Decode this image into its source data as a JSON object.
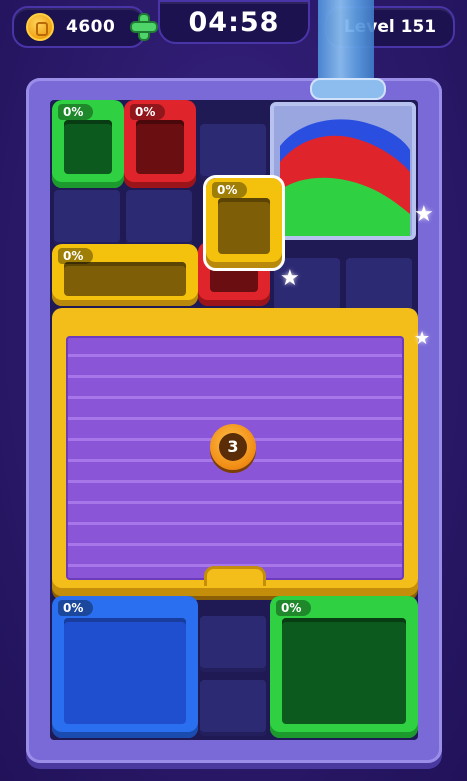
{
  "hud": {
    "coins": "4600",
    "timer": "04:58",
    "level": "Level 151"
  },
  "boxes": {
    "green_top": {
      "percent": "0%",
      "color": "#2fd142"
    },
    "red_top": {
      "percent": "0%",
      "color": "#e0242c"
    },
    "yellow_floating": {
      "percent": "0%",
      "color": "#f4c20d"
    },
    "yellow_long": {
      "percent": "0%",
      "color": "#f4c20d"
    },
    "blue_bottom": {
      "percent": "0%",
      "color": "#2a6ff0"
    },
    "green_bottom": {
      "percent": "0%",
      "color": "#2fd142"
    }
  },
  "shutter": {
    "counter": "3"
  },
  "sand_colors": [
    "#2a4fe0",
    "#e0242c",
    "#2fd142"
  ],
  "icons": [
    "coin-icon",
    "plus-icon",
    "star-icon"
  ]
}
